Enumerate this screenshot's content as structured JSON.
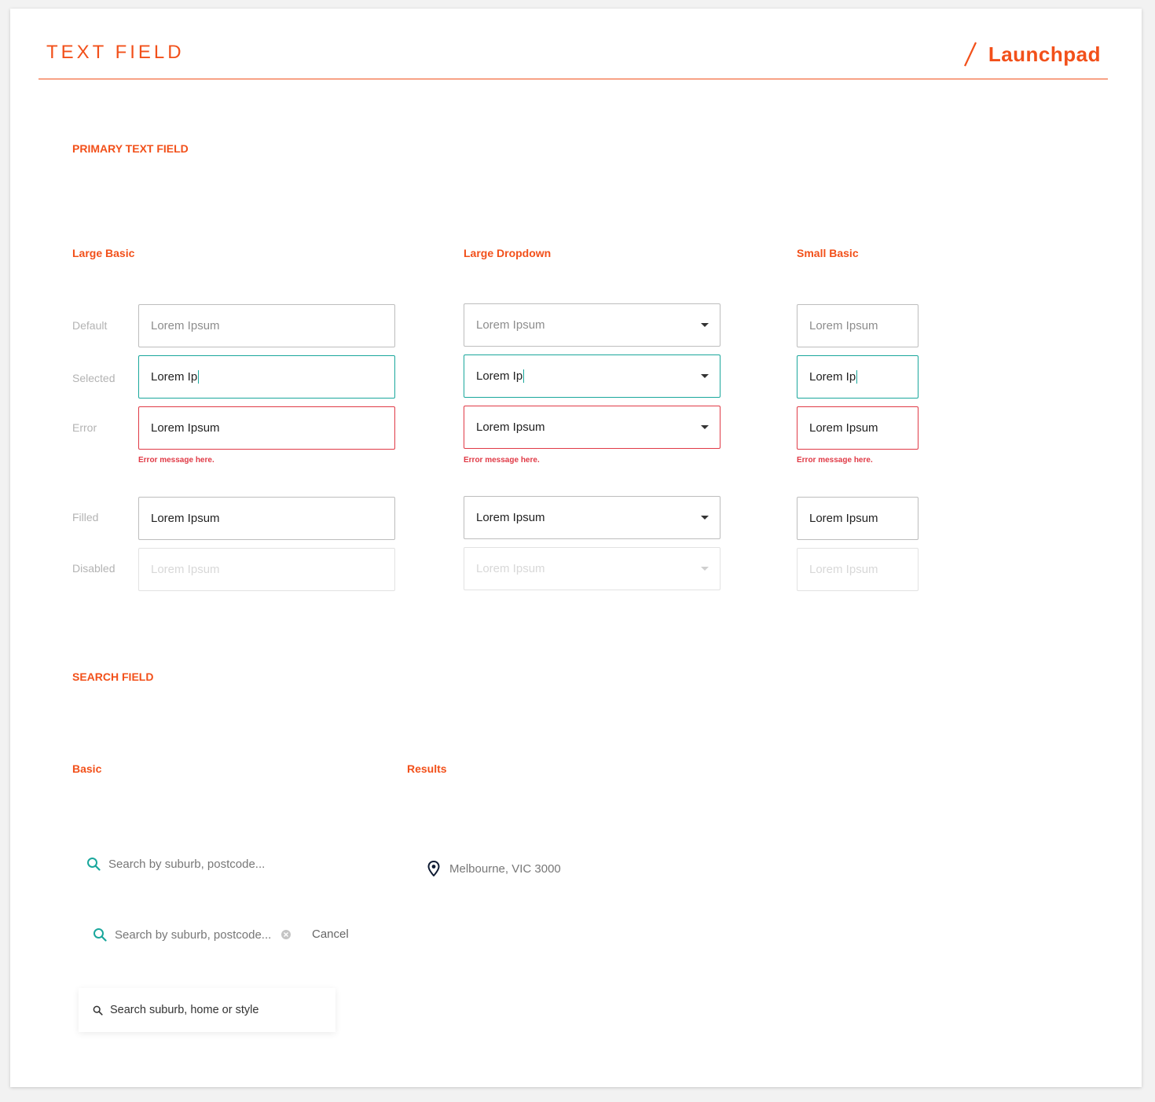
{
  "header": {
    "title": "TEXT FIELD",
    "brand": "Launchpad"
  },
  "colors": {
    "accent": "#f2501a",
    "selected": "#1aa79c",
    "error": "#e03a46"
  },
  "primary": {
    "section_title": "PRIMARY TEXT FIELD",
    "columns": {
      "large_basic": "Large Basic",
      "large_dropdown": "Large Dropdown",
      "small_basic": "Small Basic"
    },
    "row_labels": {
      "default": "Default",
      "selected": "Selected",
      "error": "Error",
      "filled": "Filled",
      "disabled": "Disabled"
    },
    "values": {
      "placeholder": "Lorem Ipsum",
      "typing": "Lorem Ip",
      "filled": "Lorem Ipsum"
    },
    "error_message": "Error message here."
  },
  "search": {
    "section_title": "SEARCH FIELD",
    "columns": {
      "basic": "Basic",
      "results": "Results"
    },
    "basic_placeholder": "Search by suburb, postcode...",
    "active_placeholder": "Search by suburb, postcode...",
    "cancel_label": "Cancel",
    "card_placeholder": "Search suburb, home or style",
    "result_item": "Melbourne, VIC 3000"
  }
}
